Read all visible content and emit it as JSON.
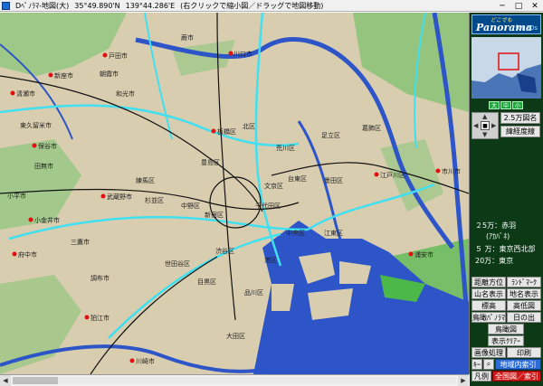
{
  "window": {
    "app_title": "Dﾍﾟﾉﾗﾏ-地図(大)",
    "lat": "35°49.890'N",
    "lon": "139°44.286'E",
    "hint": "(右クリックで縮小図／ドラッグで地図移動)",
    "minimize": "─",
    "maximize": "□",
    "close": "✕"
  },
  "colors": {
    "land": "#d9cdb0",
    "water": "#2d55c8",
    "green": "#4db84a",
    "major_road": "#40e0f0",
    "railway": "#111111",
    "panel_bg": "#0c3a16"
  },
  "map": {
    "labels": [
      {
        "text": "戸田市"
      },
      {
        "text": "川口市"
      },
      {
        "text": "蕨市"
      },
      {
        "text": "新座市"
      },
      {
        "text": "朝霞市"
      },
      {
        "text": "和光市"
      },
      {
        "text": "清瀬市"
      },
      {
        "text": "東久留米市"
      },
      {
        "text": "保谷市"
      },
      {
        "text": "田無市"
      },
      {
        "text": "板橋区"
      },
      {
        "text": "北区"
      },
      {
        "text": "荒川区"
      },
      {
        "text": "足立区"
      },
      {
        "text": "葛飾区"
      },
      {
        "text": "練馬区"
      },
      {
        "text": "豊島区"
      },
      {
        "text": "文京区"
      },
      {
        "text": "台東区"
      },
      {
        "text": "墨田区"
      },
      {
        "text": "江戸川区"
      },
      {
        "text": "市川市"
      },
      {
        "text": "小平市"
      },
      {
        "text": "武蔵野市"
      },
      {
        "text": "杉並区"
      },
      {
        "text": "中野区"
      },
      {
        "text": "新宿区"
      },
      {
        "text": "千代田区"
      },
      {
        "text": "中央区"
      },
      {
        "text": "江東区"
      },
      {
        "text": "浦安市"
      },
      {
        "text": "小金井市"
      },
      {
        "text": "三鷹市"
      },
      {
        "text": "府中市"
      },
      {
        "text": "調布市"
      },
      {
        "text": "世田谷区"
      },
      {
        "text": "渋谷区"
      },
      {
        "text": "港区"
      },
      {
        "text": "目黒区"
      },
      {
        "text": "品川区"
      },
      {
        "text": "狛江市"
      },
      {
        "text": "大田区"
      },
      {
        "text": "川崎市"
      }
    ]
  },
  "panel": {
    "logo_top": "どこでも",
    "logo_main": "Panorama",
    "logo_sub": "for 20s",
    "zoom_buttons": [
      "大",
      "中",
      "小"
    ],
    "dpad_center": "■",
    "map_25k": "2.5万図名",
    "grid_lines": "緯経度線",
    "info": [
      "２5万：赤羽",
      "(ｱｶﾊﾞﾈ)",
      "５ 万：東京西北部",
      "20万：東京"
    ],
    "buttons": {
      "distance": "距離方位",
      "landmark": "ﾗﾝﾄﾞﾏｰｸ",
      "mountain": "山名表示",
      "place": "地名表示",
      "elev": "標高",
      "high_low": "高低図",
      "bird_pano": "鳥瞰ﾊﾟﾉﾗﾏ",
      "sunrise": "日の出",
      "birdview": "鳥瞰図",
      "clear": "表示ｸﾘｱｰ",
      "image": "画像処理",
      "print": "印刷",
      "key": "ｷｰ",
      "search": "地域内索引",
      "legend": "凡例",
      "all_index": "全国図／索引"
    }
  }
}
